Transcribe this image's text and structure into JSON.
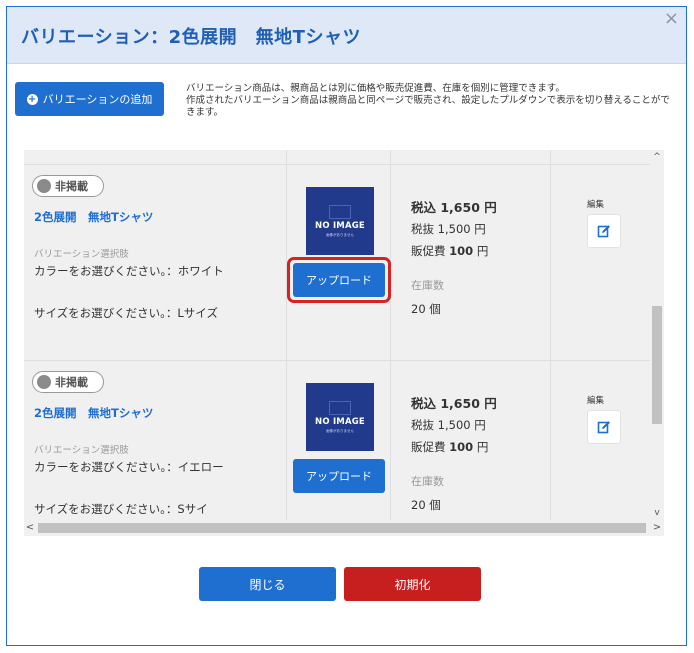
{
  "modal": {
    "title": "バリエーション：2色展開　無地Tシャツ",
    "close_symbol": "×"
  },
  "toolbar": {
    "add_label": "バリエーションの追加",
    "info_line1": "バリエーション商品は、親商品とは別に価格や販売促進費、在庫を個別に管理できます。",
    "info_line2": "作成されたバリエーション商品は親商品と同ページで販売され、設定したプルダウンで表示を切り替えることができます。"
  },
  "rows": [
    {
      "status": "非掲載",
      "name": "2色展開　無地Tシャツ",
      "variation_label": "バリエーション選択肢",
      "option1": "カラーをお選びください。：ホワイト",
      "option2": "サイズをお選びください。：Lサイズ",
      "image_text": "NO IMAGE",
      "image_sub": "画像がありません",
      "upload_label": "アップロード",
      "price_tax": "税込 1,650 円",
      "price_notax": "税抜 1,500 円",
      "promo_prefix": "販促費 ",
      "promo_value": "100",
      "promo_unit": " 円",
      "stock_label": "在庫数",
      "stock_value": "20 個",
      "edit_label": "編集"
    },
    {
      "status": "非掲載",
      "name": "2色展開　無地Tシャツ",
      "variation_label": "バリエーション選択肢",
      "option1": "カラーをお選びください。：イエロー",
      "option2": "サイズをお選びください。：Sサイ",
      "image_text": "NO IMAGE",
      "image_sub": "画像がありません",
      "upload_label": "アップロード",
      "price_tax": "税込 1,650 円",
      "price_notax": "税抜 1,500 円",
      "promo_prefix": "販促費 ",
      "promo_value": "100",
      "promo_unit": " 円",
      "stock_label": "在庫数",
      "stock_value": "20 個",
      "edit_label": "編集"
    }
  ],
  "scroll": {
    "up": "^",
    "down": "v",
    "left": "<",
    "right": ">"
  },
  "footer": {
    "close_label": "閉じる",
    "reset_label": "初期化"
  },
  "colors": {
    "primary": "#1f6fd1",
    "danger": "#c71f1f",
    "highlight": "#d72222",
    "header_bg": "#dfe8f7"
  }
}
